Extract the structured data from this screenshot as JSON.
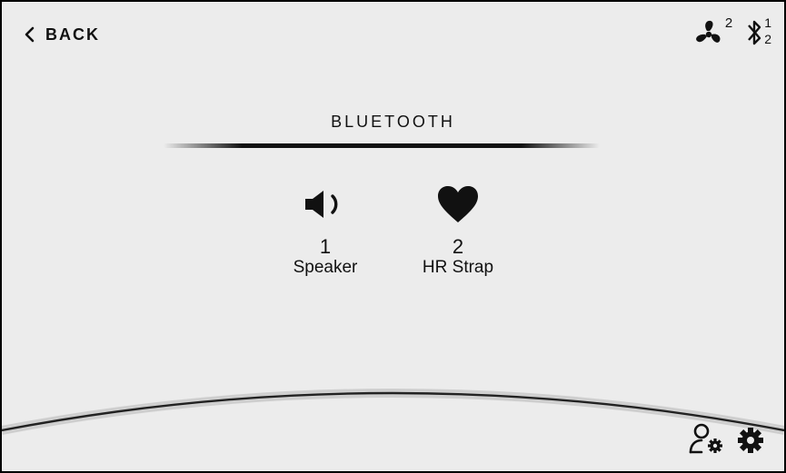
{
  "header": {
    "back_label": "BACK",
    "fan_count": "2",
    "bt_top": "1",
    "bt_bottom": "2"
  },
  "screen": {
    "title": "BLUETOOTH"
  },
  "devices": [
    {
      "number": "1",
      "label": "Speaker",
      "icon": "speaker-icon"
    },
    {
      "number": "2",
      "label": "HR Strap",
      "icon": "heart-icon"
    }
  ],
  "footer": {
    "icons": [
      "user-settings-icon",
      "gear-icon"
    ]
  }
}
